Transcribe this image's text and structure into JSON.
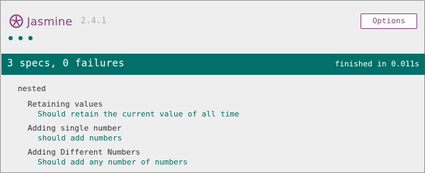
{
  "header": {
    "logo_text": "Jasmine",
    "version": "2.4.1",
    "options_label": "Options",
    "brand_color": "#8a4182"
  },
  "progress_dots": [
    "passed",
    "passed",
    "passed"
  ],
  "summary_bar": {
    "summary": "3 specs, 0 failures",
    "duration": "finished in 0.011s",
    "color": "#007069"
  },
  "suite": {
    "title": "nested",
    "children": [
      {
        "title": "Retaining values",
        "spec": "Should retain the current value of all time"
      },
      {
        "title": "Adding single number",
        "spec": "should add numbers"
      },
      {
        "title": "Adding Different Numbers",
        "spec": "Should add any number of numbers"
      }
    ]
  }
}
